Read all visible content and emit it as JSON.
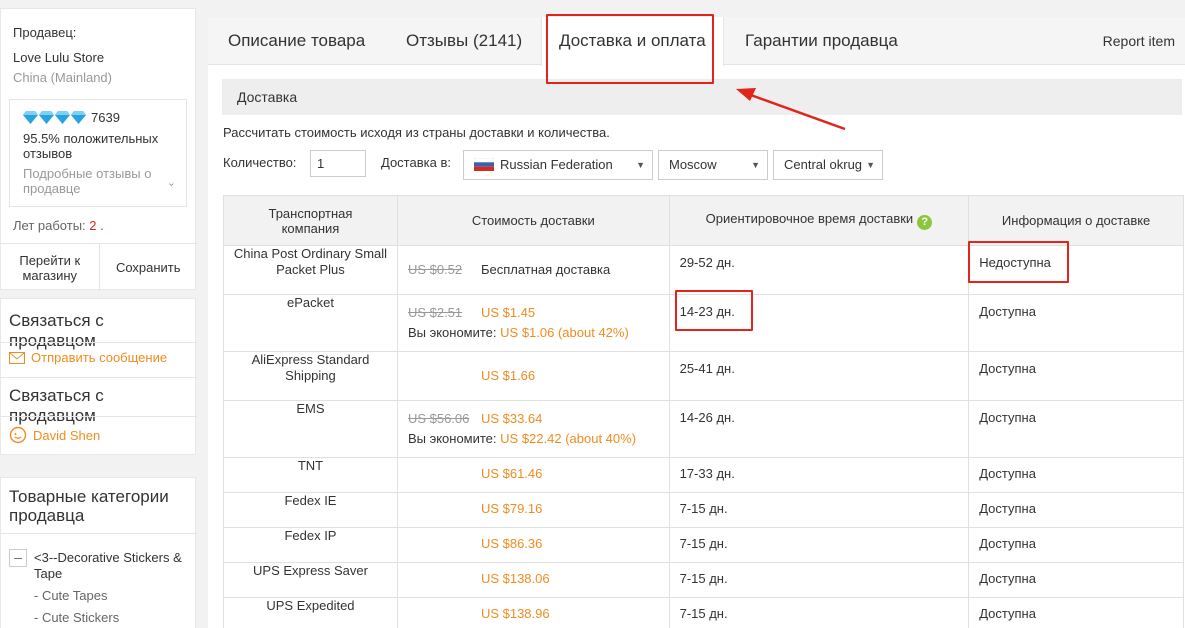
{
  "seller": {
    "label": "Продавец:",
    "store_name": "Love Lulu Store",
    "country": "China (Mainland)",
    "score": "7639",
    "positive_pct": "95.5%",
    "positive_text": "положительных отзывов",
    "detailed_link": "Подробные отзывы о продавце",
    "years_label": "Лет работы:",
    "years_value": "2 .",
    "goto_store": "Перейти к магазину",
    "save": "Сохранить"
  },
  "contact": {
    "title1": "Связаться с продавцом",
    "send_message": "Отправить сообщение",
    "title2": "Связаться с продавцом",
    "person": "David Shen"
  },
  "categories": {
    "title": "Товарные категории продавца",
    "main": "<3--Decorative Stickers & Tape",
    "sub1": "- Cute Tapes",
    "sub2": "- Cute Stickers"
  },
  "tabs": {
    "description": "Описание товара",
    "reviews": "Отзывы (2141)",
    "delivery": "Доставка и оплата",
    "guarantees": "Гарантии продавца",
    "report": "Report item"
  },
  "delivery": {
    "section_title": "Доставка",
    "calc_text": "Рассчитать стоимость исходя из страны доставки и количества.",
    "qty_label": "Количество:",
    "qty_value": "1",
    "ship_to_label": "Доставка в:",
    "country": "Russian Federation",
    "city": "Moscow",
    "district": "Central okrug"
  },
  "table": {
    "headers": [
      "Транспортная компания",
      "Стоимость доставки",
      "Ориентировочное время доставки",
      "Информация о доставке"
    ],
    "save_label": "Вы экономите:",
    "rows": [
      {
        "company": "China Post Ordinary Small Packet Plus",
        "old": "US $0.52",
        "price": "Бесплатная доставка",
        "saving": "",
        "time": "29-52 дн.",
        "info": "Недоступна"
      },
      {
        "company": "ePacket",
        "old": "US $2.51",
        "price": "US $1.45",
        "saving": "US $1.06 (about 42%)",
        "time": "14-23 дн.",
        "info": "Доступна"
      },
      {
        "company": "AliExpress Standard Shipping",
        "old": "",
        "price": "US $1.66",
        "saving": "",
        "time": "25-41 дн.",
        "info": "Доступна"
      },
      {
        "company": "EMS",
        "old": "US $56.06",
        "price": "US $33.64",
        "saving": "US $22.42 (about 40%)",
        "time": "14-26 дн.",
        "info": "Доступна"
      },
      {
        "company": "TNT",
        "old": "",
        "price": "US $61.46",
        "saving": "",
        "time": "17-33 дн.",
        "info": "Доступна"
      },
      {
        "company": "Fedex IE",
        "old": "",
        "price": "US $79.16",
        "saving": "",
        "time": "7-15 дн.",
        "info": "Доступна"
      },
      {
        "company": "Fedex IP",
        "old": "",
        "price": "US $86.36",
        "saving": "",
        "time": "7-15 дн.",
        "info": "Доступна"
      },
      {
        "company": "UPS Express Saver",
        "old": "",
        "price": "US $138.06",
        "saving": "",
        "time": "7-15 дн.",
        "info": "Доступна"
      },
      {
        "company": "UPS Expedited",
        "old": "",
        "price": "US $138.96",
        "saving": "",
        "time": "7-15 дн.",
        "info": "Доступна"
      }
    ]
  },
  "colors": {
    "accent_orange": "#f08c1f",
    "annotation_red": "#e1251b",
    "diamond_blue": "#29a3e0"
  }
}
